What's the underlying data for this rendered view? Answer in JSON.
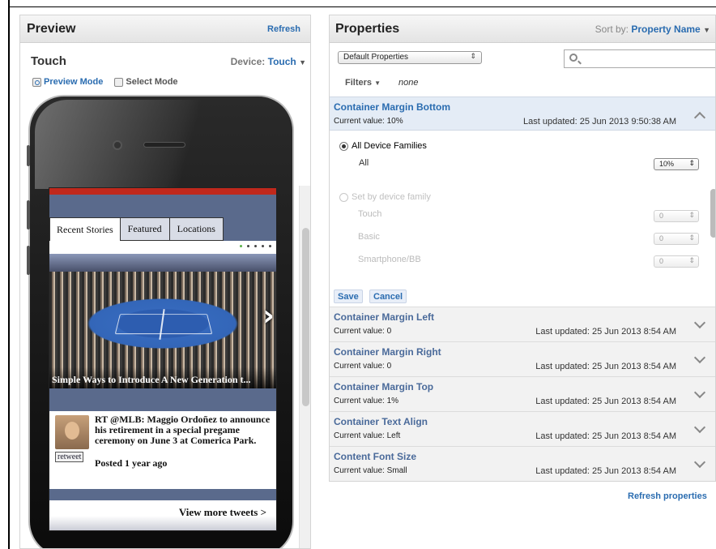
{
  "preview": {
    "title": "Preview",
    "refresh": "Refresh",
    "touch_title": "Touch",
    "device_label": "Device:",
    "device_value": "Touch",
    "preview_mode": "Preview Mode",
    "select_mode": "Select Mode"
  },
  "phone_screen": {
    "tabs": [
      "Recent Stories",
      "Featured",
      "Locations"
    ],
    "caption": "Simple Ways to Introduce A New Generation t...",
    "tweet_text": "RT @MLB: Maggio Ordoñez to announce his retirement in a special pregame ceremony on June 3 at Comerica Park.",
    "tweet_time": "Posted 1 year ago",
    "retweet": "retweet",
    "view_more": "View more tweets >"
  },
  "properties": {
    "title": "Properties",
    "sort_label": "Sort by:",
    "sort_value": "Property Name",
    "select_value": "Default Properties",
    "search_placeholder": "",
    "filters_label": "Filters",
    "filters_value": "none",
    "open_prop": {
      "name": "Container Margin Bottom",
      "current": "Current value: 10%",
      "updated": "Last updated: 25 Jun 2013 9:50:38 AM"
    },
    "editor": {
      "all_families": "All Device Families",
      "all": "All",
      "all_value": "10%",
      "set_by_family": "Set by device family",
      "families": [
        {
          "name": "Touch",
          "value": "0"
        },
        {
          "name": "Basic",
          "value": "0"
        },
        {
          "name": "Smartphone/BB",
          "value": "0"
        }
      ],
      "save": "Save",
      "cancel": "Cancel"
    },
    "rows": [
      {
        "name": "Container Margin Left",
        "current": "Current value: 0",
        "updated": "Last updated: 25 Jun 2013 8:54 AM"
      },
      {
        "name": "Container Margin Right",
        "current": "Current value: 0",
        "updated": "Last updated: 25 Jun 2013 8:54 AM"
      },
      {
        "name": "Container Margin Top",
        "current": "Current value: 1%",
        "updated": "Last updated: 25 Jun 2013 8:54 AM"
      },
      {
        "name": "Container Text Align",
        "current": "Current value: Left",
        "updated": "Last updated: 25 Jun 2013 8:54 AM"
      },
      {
        "name": "Content Font Size",
        "current": "Current value: Small",
        "updated": "Last updated: 25 Jun 2013 8:54 AM"
      }
    ],
    "refresh_properties": "Refresh properties"
  },
  "icons": {
    "preview_mode": "magnifier-icon",
    "select_mode": "select-mode-icon",
    "search": "search-icon",
    "chevron_up": "chevron-up-icon",
    "chevron_down": "chevron-down-icon"
  },
  "colors": {
    "link": "#2a6cb0",
    "header_accent": "#c0281c",
    "selected_row": "#e4ecf6"
  }
}
